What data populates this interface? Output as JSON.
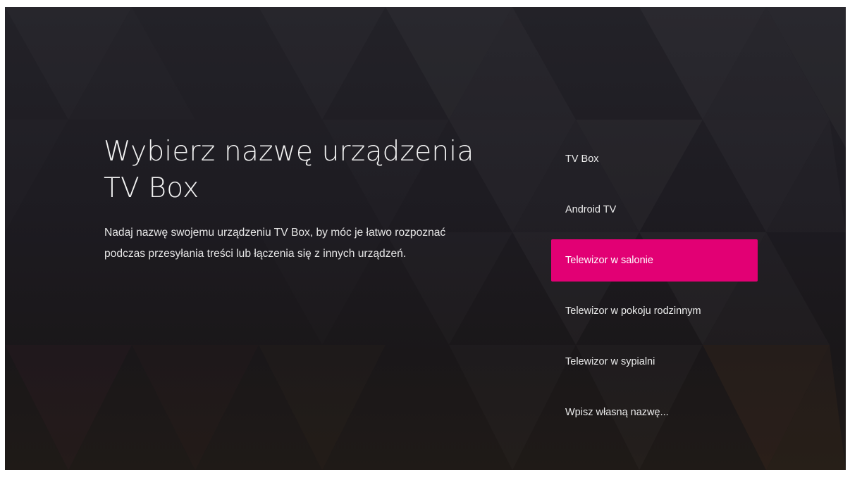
{
  "screen": {
    "title_line1": "Wybierz nazwę urządzenia",
    "title_line2": "TV Box",
    "description_line1": "Nadaj nazwę swojemu urządzeniu TV Box, by móc je łatwo rozpoznać",
    "description_line2": "podczas przesyłania treści lub łączenia się z innych urządzeń."
  },
  "options": [
    {
      "label": "TV Box"
    },
    {
      "label": "Android TV"
    },
    {
      "label": "Telewizor w salonie",
      "selected": true
    },
    {
      "label": "Telewizor w pokoju rodzinnym"
    },
    {
      "label": "Telewizor w sypialni"
    },
    {
      "label": "Wpisz własną nazwę..."
    }
  ],
  "colors": {
    "accent": "#e20074",
    "background": "#1f1d22",
    "text": "#ececec"
  }
}
